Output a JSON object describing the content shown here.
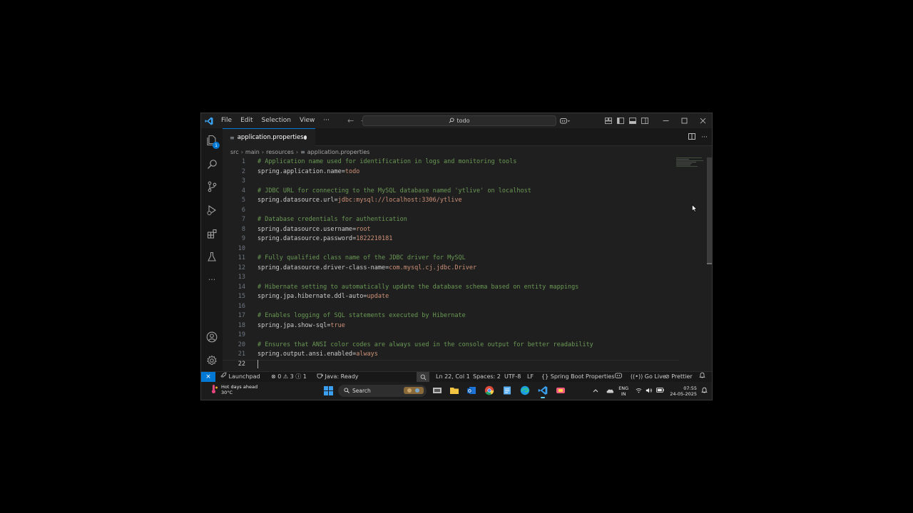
{
  "titlebar": {
    "menu": [
      "File",
      "Edit",
      "Selection",
      "View"
    ],
    "more": "···",
    "search_text": "todo"
  },
  "activity": {
    "explorer_badge": "1"
  },
  "tab": {
    "label": "application.properties"
  },
  "breadcrumb": [
    "src",
    "main",
    "resources",
    "application.properties"
  ],
  "editor": {
    "line_numbers": [
      "1",
      "2",
      "3",
      "4",
      "5",
      "6",
      "7",
      "8",
      "9",
      "10",
      "11",
      "12",
      "13",
      "14",
      "15",
      "16",
      "17",
      "18",
      "19",
      "20",
      "21",
      "22"
    ],
    "active_line": "22",
    "lines": [
      {
        "comment": "# Application name used for identification in logs and monitoring tools"
      },
      {
        "key": "spring.application.name",
        "eq": "=",
        "value": "todo"
      },
      {},
      {
        "comment": "# JDBC URL for connecting to the MySQL database named 'ytlive' on localhost"
      },
      {
        "key": "spring.datasource.url",
        "eq": "=",
        "value": "jdbc:mysql://localhost:3306/ytlive"
      },
      {},
      {
        "comment": "# Database credentials for authentication"
      },
      {
        "key": "spring.datasource.username",
        "eq": "=",
        "value": "root"
      },
      {
        "key": "spring.datasource.password",
        "eq": "=",
        "value": "1822210181"
      },
      {},
      {
        "comment": "# Fully qualified class name of the JDBC driver for MySQL"
      },
      {
        "key": "spring.datasource.driver-class-name",
        "eq": "=",
        "value": "com.mysql.cj.jdbc.Driver"
      },
      {},
      {
        "comment": "# Hibernate setting to automatically update the database schema based on entity mappings"
      },
      {
        "key": "spring.jpa.hibernate.ddl-auto",
        "eq": "=",
        "value": "update"
      },
      {},
      {
        "comment": "# Enables logging of SQL statements executed by Hibernate"
      },
      {
        "key": "spring.jpa.show-sql",
        "eq": "=",
        "value": "true"
      },
      {},
      {
        "comment": "# Ensures that ANSI color codes are always used in the console output for better readability"
      },
      {
        "key": "spring.output.ansi.enabled",
        "eq": "=",
        "value": "always"
      },
      {}
    ]
  },
  "statusbar": {
    "launchpad": "Launchpad",
    "errors": "0",
    "warnings": "3",
    "infos": "1",
    "java_status": "Java: Ready",
    "position": "Ln 22, Col 1",
    "spaces": "Spaces: 2",
    "encoding": "UTF-8",
    "eol": "LF",
    "language": "Spring Boot Properties",
    "go_live": "Go Live",
    "prettier": "Prettier"
  },
  "taskbar": {
    "weather_title": "Hot days ahead",
    "weather_temp": "30°C",
    "search_label": "Search",
    "lang_top": "ENG",
    "lang_bottom": "IN",
    "time": "07:55",
    "date": "24-05-2025"
  },
  "colors": {
    "accent": "#0078d4",
    "comment": "#6a9955",
    "string_value": "#ce9178",
    "editor_bg": "#1f1f1f"
  }
}
